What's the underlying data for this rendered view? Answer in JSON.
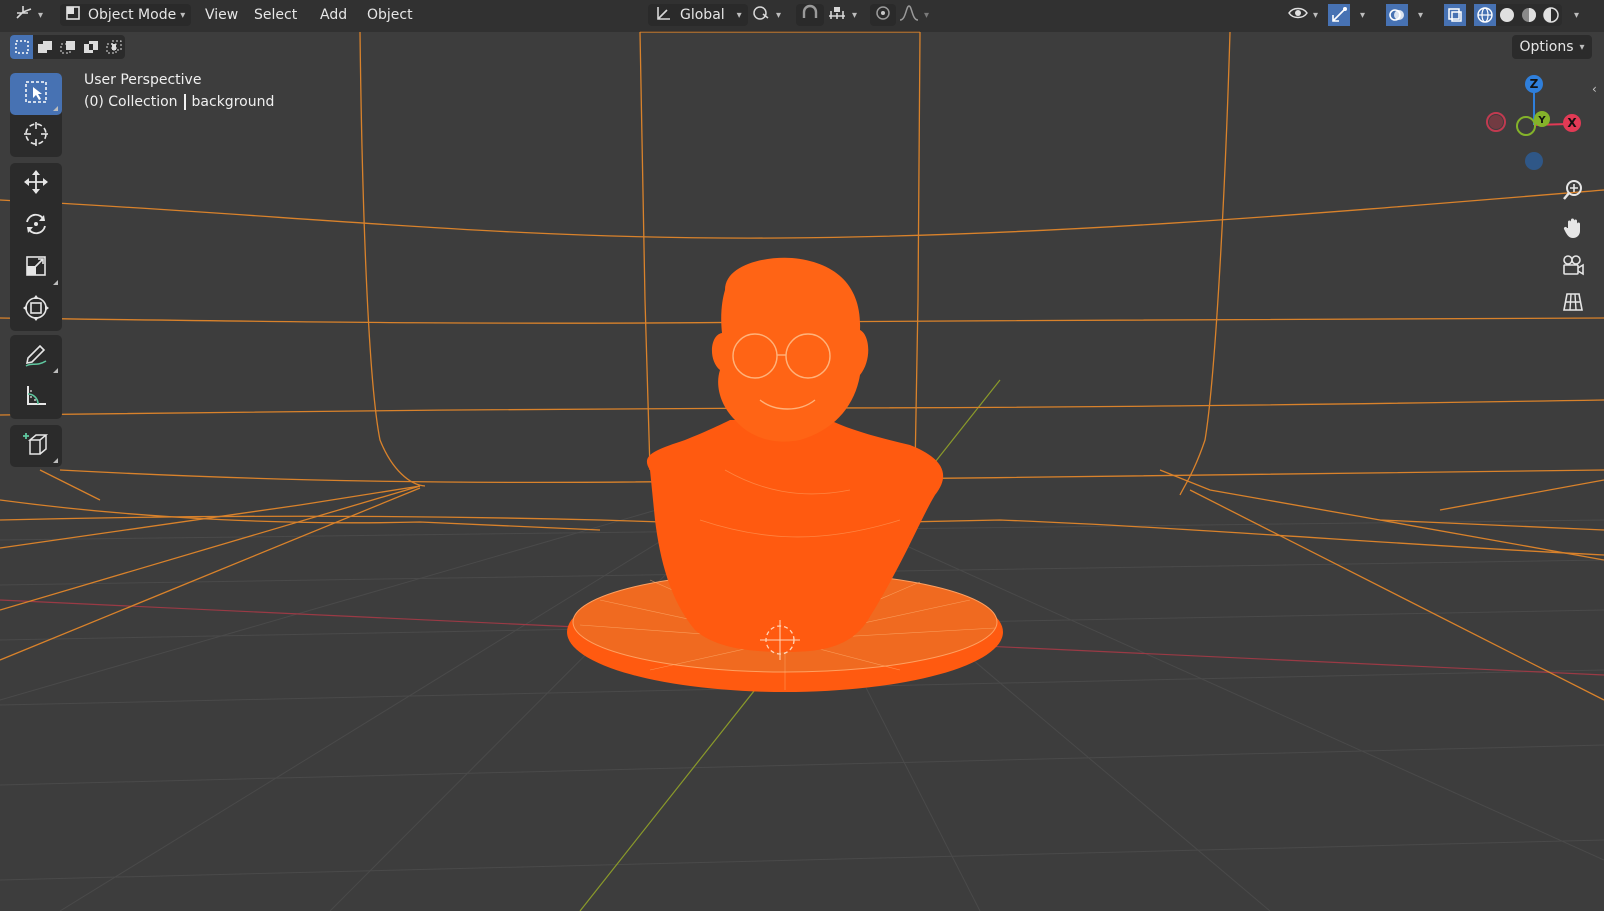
{
  "header": {
    "editor_type_icon": "3d-viewport-icon",
    "mode": {
      "icon": "object-mode-icon",
      "label": "Object Mode"
    },
    "menus": [
      "View",
      "Select",
      "Add",
      "Object"
    ],
    "orientation": {
      "icon": "transform-orientation-icon",
      "label": "Global"
    },
    "pivot_icon": "pivot-point-icon",
    "snap_icons": [
      "magnet-icon",
      "snap-increment-icon"
    ],
    "proportional_icons": [
      "proportional-edit-icon",
      "falloff-curve-icon"
    ],
    "right_icons": [
      "visibility-eye-icon",
      "gizmo-toggle-icon",
      "overlay-icon",
      "xray-icon"
    ],
    "shading_modes": [
      {
        "name": "wireframe",
        "active": true
      },
      {
        "name": "solid",
        "active": false
      },
      {
        "name": "material-preview",
        "active": false
      },
      {
        "name": "rendered",
        "active": false
      }
    ]
  },
  "select_modes": [
    {
      "name": "set-new",
      "active": true
    },
    {
      "name": "extend",
      "active": false
    },
    {
      "name": "subtract",
      "active": false
    },
    {
      "name": "difference",
      "active": false
    },
    {
      "name": "intersect",
      "active": false
    }
  ],
  "options_label": "Options",
  "toolbar": {
    "groups": [
      [
        "select-box-tool",
        "cursor-tool"
      ],
      [
        "move-tool",
        "rotate-tool",
        "scale-tool",
        "transform-tool"
      ],
      [
        "annotate-tool",
        "measure-tool"
      ],
      [
        "add-cube-tool"
      ]
    ],
    "active_tool": "select-box-tool"
  },
  "overlay": {
    "view_name": "User Perspective",
    "collection": "(0) Collection",
    "object": "background"
  },
  "gizmo": {
    "axes": [
      "Z",
      "Y",
      "X"
    ],
    "colors": {
      "x": "#e23a55",
      "y": "#84b32a",
      "z": "#2f7fdb"
    }
  },
  "nav_buttons": [
    "zoom-icon",
    "pan-hand-icon",
    "camera-view-icon",
    "ortho-grid-icon"
  ],
  "scene": {
    "selection_color": "#ff6a1a",
    "wire_color": "#d9822b",
    "grid_color": "#4d4d4d",
    "x_axis_color": "#b03a48",
    "y_axis_color": "#8a9a2a"
  }
}
